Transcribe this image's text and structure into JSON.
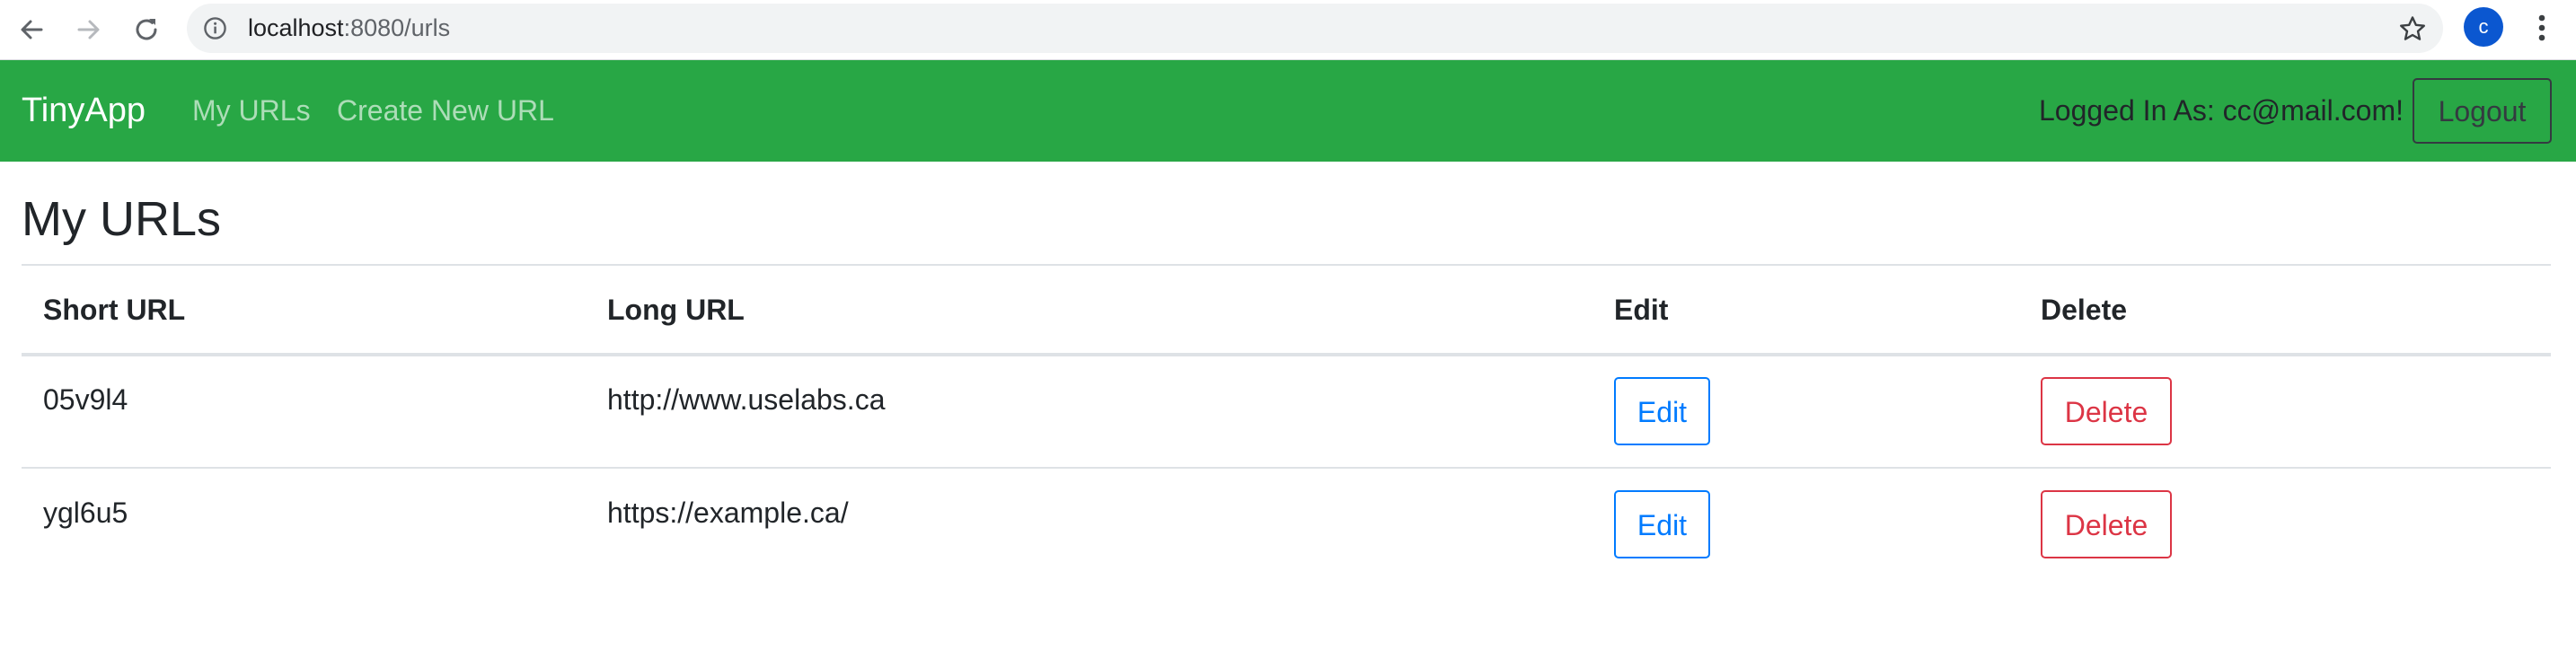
{
  "browser": {
    "url_host": "localhost",
    "url_path": ":8080/urls",
    "profile_initial": "c"
  },
  "navbar": {
    "brand": "TinyApp",
    "links": [
      "My URLs",
      "Create New URL"
    ],
    "logged_in_text": "Logged In As: cc@mail.com!",
    "logout_label": "Logout",
    "color": "#28a745"
  },
  "main": {
    "title": "My URLs",
    "table": {
      "headers": [
        "Short URL",
        "Long URL",
        "Edit",
        "Delete"
      ],
      "rows": [
        {
          "short": "05v9l4",
          "long": "http://www.uselabs.ca",
          "edit_label": "Edit",
          "delete_label": "Delete"
        },
        {
          "short": "ygl6u5",
          "long": "https://example.ca/",
          "edit_label": "Edit",
          "delete_label": "Delete"
        }
      ]
    }
  },
  "icons": {
    "back": "arrow-left-icon",
    "forward": "arrow-right-icon",
    "reload": "reload-icon",
    "info": "info-icon",
    "bookmark": "star-icon",
    "menu": "kebab-menu-icon"
  },
  "colors": {
    "edit": "#007bff",
    "delete": "#dc3545"
  }
}
